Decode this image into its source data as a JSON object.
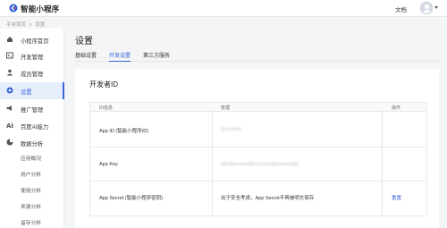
{
  "header": {
    "brand": "智能小程序",
    "doc_link": "文档"
  },
  "breadcrumb": [
    "平台首页",
    ">",
    "设置"
  ],
  "sidebar": {
    "items": [
      {
        "label": "小程序首页",
        "icon": "home-icon"
      },
      {
        "label": "开发管理",
        "icon": "code-icon"
      },
      {
        "label": "成员管理",
        "icon": "user-icon"
      },
      {
        "label": "设置",
        "icon": "settings-icon",
        "active": true
      },
      {
        "label": "推广管理",
        "icon": "megaphone-icon"
      },
      {
        "label": "百度AI能力",
        "icon": "ai-icon"
      },
      {
        "label": "数据分析",
        "icon": "pie-chart-icon"
      }
    ],
    "sub_items": [
      "应用概况",
      "用户分析",
      "使用分析",
      "来源分析",
      "留存分析"
    ]
  },
  "main": {
    "title": "设置",
    "tabs": [
      {
        "label": "基础设置"
      },
      {
        "label": "开发设置",
        "active": true
      },
      {
        "label": "第三方服务"
      }
    ],
    "section_title": "开发者ID",
    "table": {
      "columns": [
        "ID信息",
        "管理",
        "操作"
      ],
      "rows": [
        {
          "name": "App ID (智能小程序ID)",
          "value": "11•••••••6",
          "action": ""
        },
        {
          "name": "App Key",
          "value": "wFxd•••••••••xK•••••J•••••k•••••••••2nt",
          "action": ""
        },
        {
          "name": "App Secret (智能小程序密钥)",
          "value": "出于安全考虑，App Secret不再被明文保存",
          "action": "重置"
        }
      ]
    }
  },
  "colors": {
    "accent": "#3b66d9",
    "active_bg": "#e6eefc"
  }
}
